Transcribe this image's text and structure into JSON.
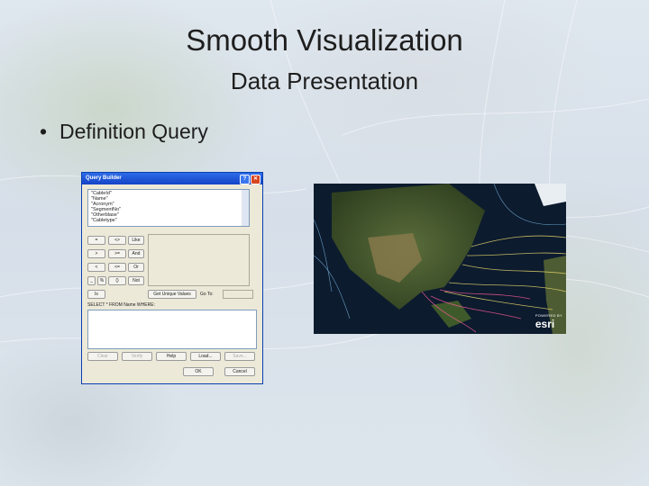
{
  "slide": {
    "title": "Smooth Visualization",
    "subtitle": "Data Presentation",
    "bullet": "Definition Query"
  },
  "query_builder": {
    "title": "Query Builder",
    "fields": [
      "\"CableId\"",
      "\"Name\"",
      "\"Acronym\"",
      "\"SegmentNo\"",
      "\"Otherblase\"",
      "\"Cabletype\""
    ],
    "operators": [
      [
        "=",
        "<>",
        "Like"
      ],
      [
        ">",
        ">=",
        "And"
      ],
      [
        "<",
        "<=",
        "Or"
      ],
      [
        "_",
        "%",
        "()",
        "Not"
      ],
      [
        "Is"
      ]
    ],
    "unique_values_button": "Get Unique Values",
    "goto_label": "Go To:",
    "sql_label": "SELECT * FROM Name WHERE:",
    "buttons": {
      "clear": "Clear",
      "verify": "Verify",
      "help": "Help",
      "load": "Load...",
      "save": "Save..."
    },
    "ok": "OK",
    "cancel": "Cancel"
  },
  "map": {
    "badge_small": "POWERED BY",
    "badge": "esri"
  }
}
